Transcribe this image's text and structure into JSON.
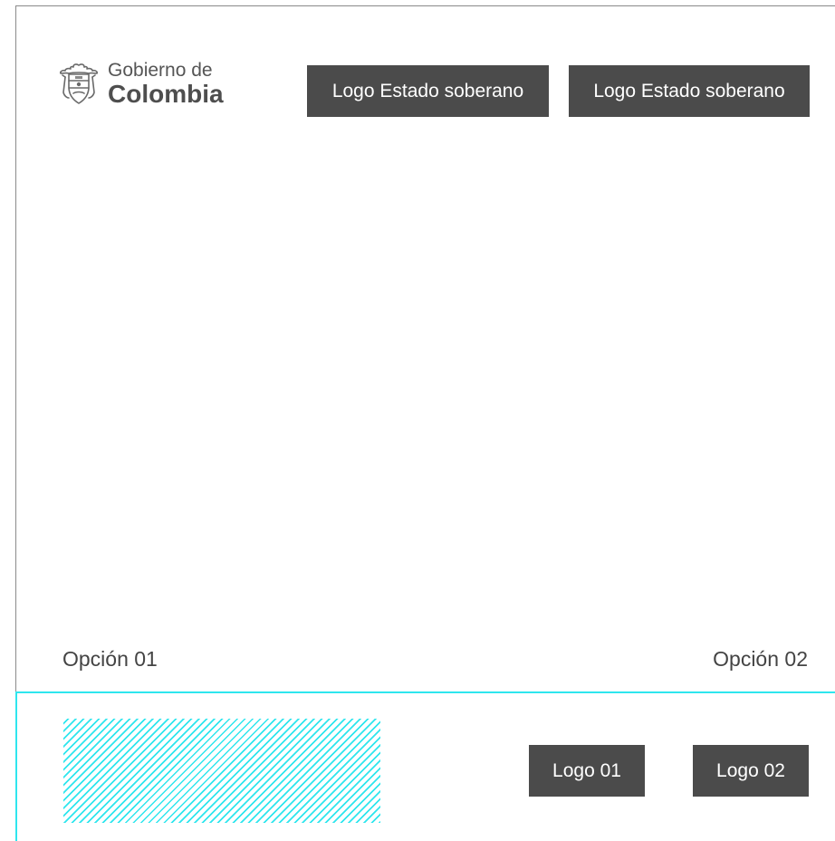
{
  "brand": {
    "line1": "Gobierno de",
    "line2": "Colombia",
    "icon": "coat-of-arms-icon"
  },
  "header": {
    "placeholders": [
      "Logo Estado soberano",
      "Logo Estado soberano"
    ]
  },
  "options": {
    "left": "Opción 01",
    "right": "Opción 02"
  },
  "footer": {
    "logos": [
      "Logo 01",
      "Logo 02"
    ]
  },
  "colors": {
    "placeholder_bg": "#4b4b4b",
    "placeholder_text": "#ffffff",
    "accent_cyan": "#2ee6ee",
    "frame_line": "#8a8a8a",
    "text": "#444444"
  }
}
